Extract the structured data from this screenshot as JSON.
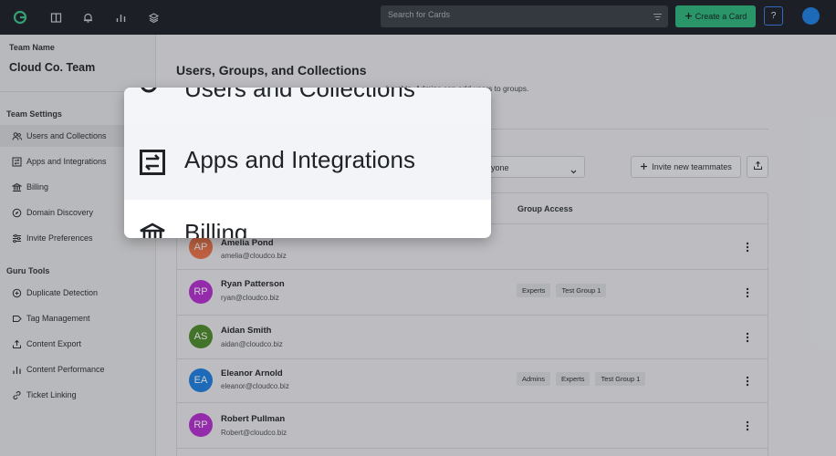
{
  "topbar": {
    "search_placeholder": "Search for Cards",
    "create_label": "Create a Card",
    "help_label": "?",
    "icons": [
      "guru-logo-icon",
      "book-icon",
      "bell-icon",
      "bar-chart-icon",
      "layers-icon"
    ]
  },
  "sidebar": {
    "team_label": "Team Name",
    "team_name": "Cloud Co. Team",
    "settings_heading": "Team Settings",
    "settings_items": [
      {
        "label": "Users and Collections",
        "icon": "users-icon"
      },
      {
        "label": "Apps and Integrations",
        "icon": "integrations-icon"
      },
      {
        "label": "Billing",
        "icon": "bank-icon"
      },
      {
        "label": "Domain Discovery",
        "icon": "compass-icon"
      },
      {
        "label": "Invite Preferences",
        "icon": "sliders-icon"
      }
    ],
    "tools_heading": "Guru Tools",
    "tools_items": [
      {
        "label": "Duplicate Detection",
        "icon": "duplicate-icon"
      },
      {
        "label": "Tag Management",
        "icon": "tag-icon"
      },
      {
        "label": "Content Export",
        "icon": "export-icon"
      },
      {
        "label": "Content Performance",
        "icon": "bar-chart-icon"
      },
      {
        "label": "Ticket Linking",
        "icon": "link-icon"
      }
    ]
  },
  "main": {
    "title": "Users, Groups, and Collections",
    "subtitle_fragment": "bership. Admins can add users to groups.",
    "filter_label_fragment": "y",
    "select_value": "yone",
    "invite_label": "Invite new teammates",
    "group_access_header": "Group Access"
  },
  "users": [
    {
      "initials": "AP",
      "name": "Amelia Pond",
      "email": "amelia@cloudco.biz",
      "color": "#e8734a",
      "tags": []
    },
    {
      "initials": "RP",
      "name": "Ryan Patterson",
      "email": "ryan@cloudco.biz",
      "color": "#b52fd1",
      "tags": [
        "Experts",
        "Test Group 1"
      ]
    },
    {
      "initials": "AS",
      "name": "Aidan Smith",
      "email": "aidan@cloudco.biz",
      "color": "#4e8a2b",
      "tags": []
    },
    {
      "initials": "EA",
      "name": "Eleanor Arnold",
      "email": "eleanor@cloudco.biz",
      "color": "#1d7fe2",
      "tags": [
        "Admins",
        "Experts",
        "Test Group 1"
      ]
    },
    {
      "initials": "RP",
      "name": "Robert Pullman",
      "email": "Robert@cloudco.biz",
      "color": "#b52fd1",
      "tags": []
    }
  ],
  "zoom": {
    "partial_top": "Users and Collections",
    "focused": "Apps and Integrations",
    "partial_bottom": "Billing"
  },
  "colors": {
    "accent_green": "#2fb77e",
    "topbar_bg": "#1b2027",
    "avatar_blue": "#1d7fe2"
  }
}
